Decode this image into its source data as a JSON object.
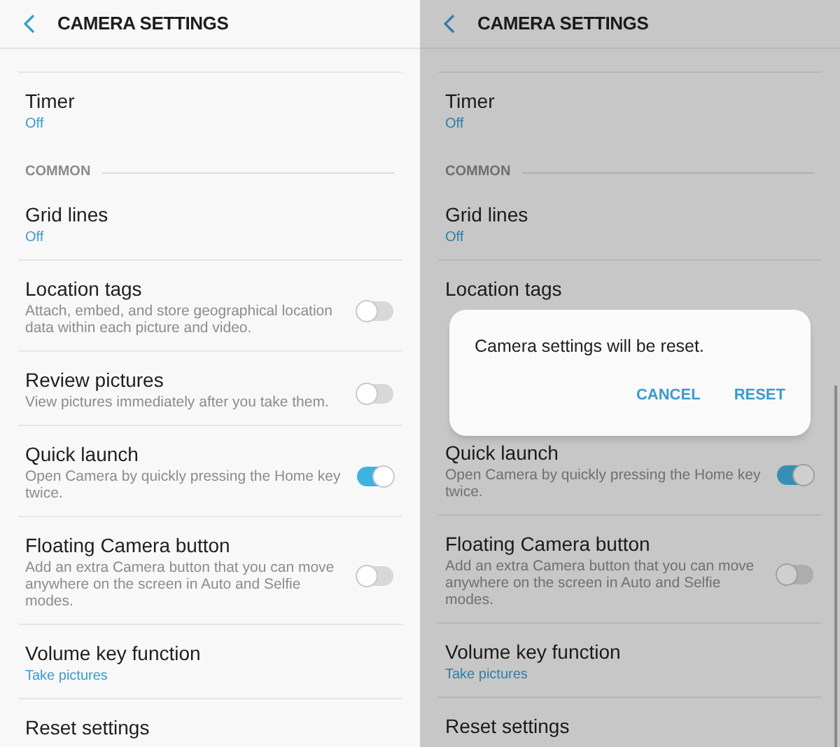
{
  "screens": [
    {
      "title": "CAMERA SETTINGS",
      "dimmed": false,
      "rows": [
        {
          "kind": "value",
          "title": "Timer",
          "value": "Off"
        },
        {
          "kind": "section",
          "title": "COMMON"
        },
        {
          "kind": "value",
          "title": "Grid lines",
          "value": "Off"
        },
        {
          "kind": "toggle",
          "title": "Location tags",
          "description": "Attach, embed, and store geographical location data within each picture and video.",
          "on": false
        },
        {
          "kind": "toggle",
          "title": "Review pictures",
          "description": "View pictures immediately after you take them.",
          "on": false
        },
        {
          "kind": "toggle",
          "title": "Quick launch",
          "description": "Open Camera by quickly pressing the Home key twice.",
          "on": true
        },
        {
          "kind": "toggle",
          "title": "Floating Camera button",
          "description": "Add an extra Camera button that you can move anywhere on the screen in Auto and Selfie modes.",
          "on": false
        },
        {
          "kind": "value",
          "title": "Volume key function",
          "value": "Take pictures"
        },
        {
          "kind": "plain",
          "title": "Reset settings"
        }
      ]
    },
    {
      "title": "CAMERA SETTINGS",
      "dimmed": true,
      "rows": [
        {
          "kind": "value",
          "title": "Timer",
          "value": "Off"
        },
        {
          "kind": "section",
          "title": "COMMON"
        },
        {
          "kind": "value",
          "title": "Grid lines",
          "value": "Off"
        },
        {
          "kind": "toggle",
          "title": "Location tags"
        },
        {
          "kind": "covered"
        },
        {
          "kind": "toggle",
          "title": "Quick launch",
          "description": "Open Camera by quickly pressing the Home key twice.",
          "on": true
        },
        {
          "kind": "toggle",
          "title": "Floating Camera button",
          "description": "Add an extra Camera button that you can move anywhere on the screen in Auto and Selfie modes.",
          "on": false
        },
        {
          "kind": "value",
          "title": "Volume key function",
          "value": "Take pictures"
        },
        {
          "kind": "plain",
          "title": "Reset settings"
        }
      ],
      "dialog": {
        "message": "Camera settings will be reset.",
        "buttons": [
          "CANCEL",
          "RESET"
        ]
      }
    }
  ]
}
